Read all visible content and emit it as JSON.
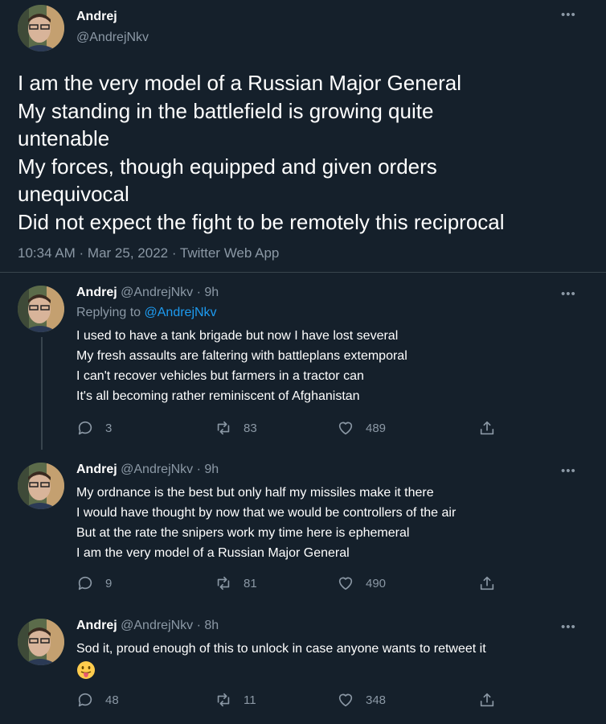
{
  "main_tweet": {
    "name": "Andrej",
    "handle": "@AndrejNkv",
    "lines": [
      "I am the very model of a Russian Major General",
      "My standing in the battlefield is growing quite",
      "untenable",
      "My forces, though equipped and given orders",
      "unequivocal",
      "Did not expect the fight to be remotely this reciprocal"
    ],
    "meta": "10:34 AM · Mar 25, 2022 · Twitter Web App",
    "more_icon": "more-horizontal-icon"
  },
  "replies": [
    {
      "name": "Andrej",
      "handle_time": "@AndrejNkv · 9h",
      "replying_prefix": "Replying to ",
      "replying_to": "@AndrejNkv",
      "lines": [
        "I used to have a tank brigade but now I have lost several",
        "My fresh assaults are faltering with battleplans extemporal",
        "I can't recover vehicles but farmers in a tractor can",
        "It's all becoming rather reminiscent of Afghanistan"
      ],
      "replies": "3",
      "retweets": "83",
      "likes": "489"
    },
    {
      "name": "Andrej",
      "handle_time": "@AndrejNkv · 9h",
      "lines": [
        "My ordnance is the best but only half my missiles make it there",
        "I would have thought by now that we would be controllers of the air",
        "But at the rate the snipers work my time here is ephemeral",
        "I am the very model of a Russian Major General"
      ],
      "replies": "9",
      "retweets": "81",
      "likes": "490"
    },
    {
      "name": "Andrej",
      "handle_time": "@AndrejNkv · 8h",
      "lines": [
        "Sod it, proud enough of this to unlock in case anyone wants to retweet it"
      ],
      "emoji": "tongue-out-emoji",
      "replies": "48",
      "retweets": "11",
      "likes": "348"
    }
  ],
  "colors": {
    "background": "#15202b",
    "text": "#ffffff",
    "secondary": "#8b98a5",
    "link": "#1d9bf0",
    "divider": "#38444d"
  }
}
